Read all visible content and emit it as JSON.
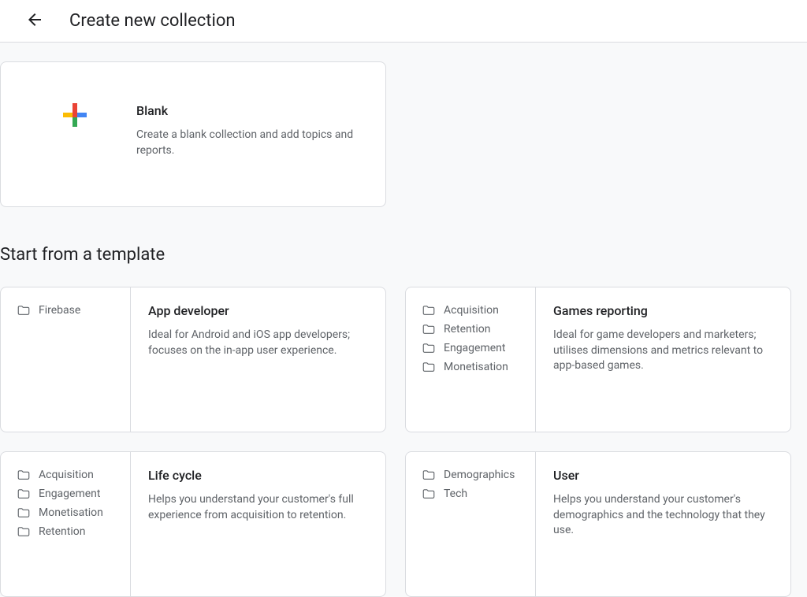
{
  "header": {
    "title": "Create new collection"
  },
  "blank": {
    "title": "Blank",
    "description": "Create a blank collection and add topics and reports."
  },
  "section_heading": "Start from a template",
  "templates": [
    {
      "tags": [
        "Firebase"
      ],
      "title": "App developer",
      "description": "Ideal for Android and iOS app developers; focuses on the in-app user experience."
    },
    {
      "tags": [
        "Acquisition",
        "Retention",
        "Engagement",
        "Monetisation"
      ],
      "title": "Games reporting",
      "description": "Ideal for game developers and marketers; utilises dimensions and metrics relevant to app-based games."
    },
    {
      "tags": [
        "Acquisition",
        "Engagement",
        "Monetisation",
        "Retention"
      ],
      "title": "Life cycle",
      "description": "Helps you understand your customer's full experience from acquisition to retention."
    },
    {
      "tags": [
        "Demographics",
        "Tech"
      ],
      "title": "User",
      "description": "Helps you understand your customer's demographics and the technology that they use."
    }
  ]
}
